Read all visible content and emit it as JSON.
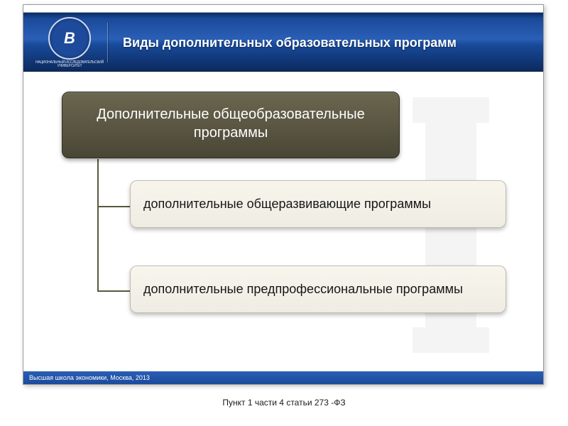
{
  "header": {
    "logo_letter": "B",
    "logo_subtext": "НАЦИОНАЛЬНЫЙ ИССЛЕДОВАТЕЛЬСКИЙ УНИВЕРСИТЕТ",
    "title": "Виды дополнительных образовательных программ"
  },
  "diagram": {
    "parent": "Дополнительные общеобразовательные программы",
    "children": [
      "дополнительные общеразвивающие программы",
      "дополнительные предпрофессиональные программы"
    ]
  },
  "footer": "Высшая школа экономики, Москва, 2013",
  "caption": "Пункт 1 части 4 статьи 273 -ФЗ"
}
